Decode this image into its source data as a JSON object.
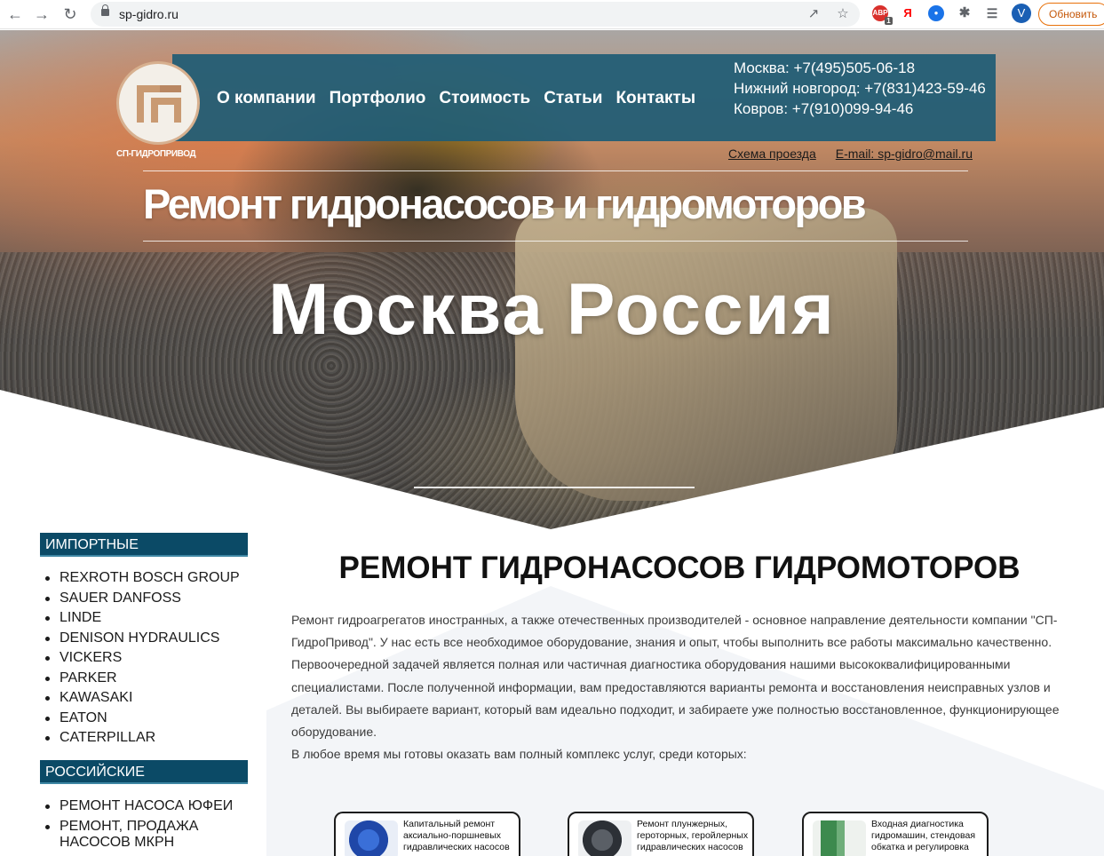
{
  "browser": {
    "back_icon": "arrow-left-icon",
    "forward_icon": "arrow-right-icon",
    "reload_icon": "reload-icon",
    "url": "sp-gidro.ru",
    "extension_badge": "1",
    "yandex_label": "Я",
    "profile_initial": "V",
    "update_label": "Обновить"
  },
  "site": {
    "logo_text": "СП-ГИДРОПРИВОД",
    "menu": [
      "О компании",
      "Портфолио",
      "Стоимость",
      "Статьи",
      "Контакты"
    ],
    "phones": [
      "Москва: +7(495)505-06-18",
      "Нижний новгород: +7(831)423-59-46",
      "Ковров: +7(910)099-94-46"
    ],
    "route_link": "Схема проезда",
    "email_link": "E-mail: sp-gidro@mail.ru",
    "hero_title": "Ремонт гидронасосов и гидромоторов",
    "hero_subtitle": "Москва Россия"
  },
  "sidebar": {
    "imported_header": "ИМПОРТНЫЕ",
    "imported": [
      "REXROTH BOSCH GROUP",
      "SAUER DANFOSS",
      "LINDE",
      "DENISON HYDRAULICS",
      "VICKERS",
      "PARKER",
      "KAWASAKI",
      "EATON",
      "CATERPILLAR"
    ],
    "russian_header": "РОССИЙСКИЕ",
    "russian": [
      "РЕМОНТ НАСОСА ЮФЕИ",
      "РЕМОНТ, ПРОДАЖА НАСОСОВ МКРН"
    ]
  },
  "main": {
    "title": "РЕМОНТ ГИДРОНАСОСОВ ГИДРОМОТОРОВ",
    "paragraphs": [
      "Ремонт гидроагрегатов иностранных, а также отечественных производителей - основное направление деятельности компании \"СП-ГидроПривод\". У нас есть все необходимое оборудование, знания и опыт, чтобы выполнить все работы максимально качественно.",
      "Первоочередной задачей является полная или частичная диагностика оборудования нашими высококвалифицированными специалистами. После полученной информации, вам предоставляются варианты ремонта и восстановления неисправных узлов и деталей. Вы выбираете вариант, который вам идеально подходит, и забираете уже полностью восстановленное, функционирующее оборудование.",
      "В любое время мы готовы оказать вам полный комплекс услуг, среди которых:"
    ],
    "services": [
      {
        "text": "Капитальный ремонт аксиально-поршневых гидравлических насосов",
        "image": "axial-pump-image"
      },
      {
        "text": "Ремонт плунжерных, героторных, геройлерных гидравлических насосов",
        "image": "plunger-pump-image"
      },
      {
        "text": "Входная диагностика гидромашин, стендовая обкатка и регулировка",
        "image": "test-stand-image"
      }
    ]
  },
  "colors": {
    "header_bar": "#1f5c75",
    "sidebar_header": "#0b4a66",
    "update_button": "#e8710a"
  }
}
